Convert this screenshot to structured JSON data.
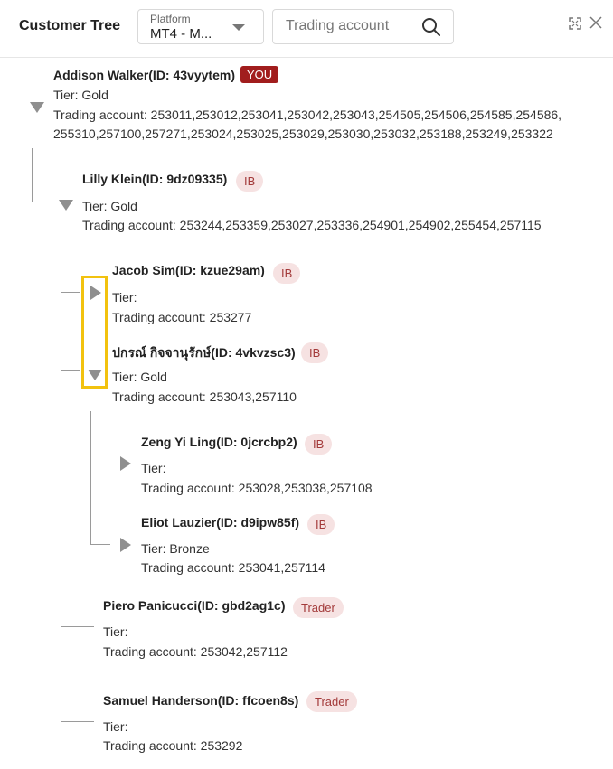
{
  "header": {
    "title": "Customer Tree",
    "platform_label": "Platform",
    "platform_value": "MT4 - M...",
    "search_placeholder": "Trading account"
  },
  "nodes": [
    {
      "name": "Addison Walker(ID: 43vyytem)",
      "badge": "YOU",
      "tier": "Tier: Gold",
      "accounts_line1": "Trading account: 253011,253012,253041,253042,253043,254505,254506,254585,254586,",
      "accounts_line2": "255310,257100,257271,253024,253025,253029,253030,253032,253188,253249,253322"
    },
    {
      "name": "Lilly Klein(ID: 9dz09335)",
      "badge": "IB",
      "tier": "Tier: Gold",
      "accounts": "Trading account: 253244,253359,253027,253336,254901,254902,255454,257115"
    },
    {
      "name": "Jacob Sim(ID: kzue29am)",
      "badge": "IB",
      "tier": "Tier:",
      "accounts": "Trading account: 253277"
    },
    {
      "name": "ปกรณ์ กิจจานุรักษ์(ID: 4vkvzsc3)",
      "badge": "IB",
      "tier": "Tier: Gold",
      "accounts": "Trading account: 253043,257110"
    },
    {
      "name": "Zeng Yi Ling(ID: 0jcrcbp2)",
      "badge": "IB",
      "tier": "Tier:",
      "accounts": "Trading account: 253028,253038,257108"
    },
    {
      "name": "Eliot Lauzier(ID: d9ipw85f)",
      "badge": "IB",
      "tier": "Tier: Bronze",
      "accounts": "Trading account: 253041,257114"
    },
    {
      "name": "Piero Panicucci(ID: gbd2ag1c)",
      "badge": "Trader",
      "tier": "Tier:",
      "accounts": "Trading account: 253042,257112"
    },
    {
      "name": "Samuel Handerson(ID: ffcoen8s)",
      "badge": "Trader",
      "tier": "Tier:",
      "accounts": "Trading account: 253292"
    }
  ]
}
